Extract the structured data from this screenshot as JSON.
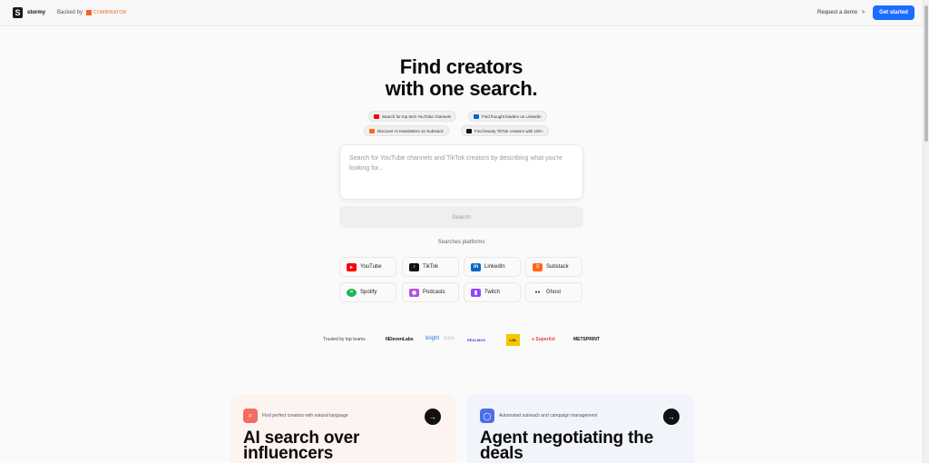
{
  "brand": {
    "name": "stormy",
    "logo_letter": "S"
  },
  "nav": {
    "backed_by": "Backed by",
    "backer_name": "COMBINATOR",
    "request_demo": "Request a demo",
    "demo_chevron": ">",
    "get_started": "Get started"
  },
  "hero": {
    "title_line1": "Find creators",
    "title_line2": "with one search."
  },
  "chips": [
    {
      "label": "Search for top tech YouTube channels",
      "icon": "youtube-icon",
      "color": "#ff0000"
    },
    {
      "label": "Find thought leaders on LinkedIn",
      "icon": "linkedin-icon",
      "color": "#0a66c2"
    },
    {
      "label": "Discover AI newsletters on Substack",
      "icon": "substack-icon",
      "color": "#ff6719"
    },
    {
      "label": "Find beauty TikTok creators with 10K+",
      "icon": "tiktok-icon",
      "color": "#111111"
    }
  ],
  "search": {
    "placeholder": "Search for YouTube channels and TikTok creators by describing what you're looking for...",
    "button": "Search"
  },
  "platforms": {
    "label": "Searches platforms",
    "items": [
      {
        "name": "YouTube",
        "icon": "youtube-icon",
        "color": "#ff0000"
      },
      {
        "name": "TikTok",
        "icon": "tiktok-icon",
        "color": "#111111"
      },
      {
        "name": "LinkedIn",
        "icon": "linkedin-icon",
        "color": "#0a66c2"
      },
      {
        "name": "Substack",
        "icon": "substack-icon",
        "color": "#ff6719"
      },
      {
        "name": "Spotify",
        "icon": "spotify-icon",
        "color": "#1db954"
      },
      {
        "name": "Podcasts",
        "icon": "podcasts-icon",
        "color": "#b150e2"
      },
      {
        "name": "Twitch",
        "icon": "twitch-icon",
        "color": "#9146ff"
      },
      {
        "name": "Ghost",
        "icon": "ghost-icon",
        "color": "#444444"
      }
    ]
  },
  "trusted": {
    "label": "Trusted by top teams",
    "logos": [
      "IIElevenLabs",
      "bright",
      "data",
      "REALMOS",
      "LOL",
      "Superlist",
      "METSPRINT"
    ]
  },
  "features": [
    {
      "subtitle": "Find perfect creators with natural language",
      "title": "AI search over influencers",
      "icon": "search-icon",
      "color": "#f26c5f"
    },
    {
      "subtitle": "Automated outreach and campaign management",
      "title": "Agent negotiating the deals",
      "icon": "chat-icon",
      "color": "#4d6fe8"
    }
  ],
  "colors": {
    "accent": "#1a6dff",
    "card_pink": "#fdf3f1",
    "card_blue": "#f2f4fb"
  }
}
